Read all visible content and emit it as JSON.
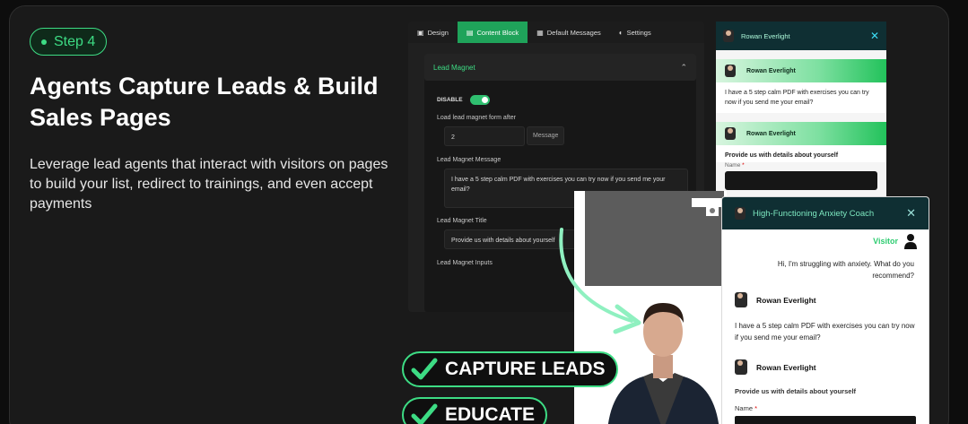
{
  "step_badge": "Step 4",
  "headline": "Agents Capture Leads & Build Sales Pages",
  "description": "Leverage lead agents that interact with visitors on pages to build your list, redirect to trainings, and even accept payments",
  "builder": {
    "tabs": [
      {
        "label": "Design",
        "icon": "layout-icon"
      },
      {
        "label": "Content Block",
        "icon": "block-icon"
      },
      {
        "label": "Default Messages",
        "icon": "message-icon"
      },
      {
        "label": "Settings",
        "icon": "gear-icon"
      }
    ],
    "section_title": "Lead Magnet",
    "disable_label": "DISABLE",
    "after_label": "Load lead magnet form after",
    "after_value": "2",
    "after_suffix": "Message",
    "message_label": "Lead Magnet Message",
    "message_value": "I have a 5 step calm PDF with exercises you can try now if you send me your email?",
    "title_label": "Lead Magnet Title",
    "title_value": "Provide us with details about yourself",
    "inputs_label": "Lead Magnet Inputs"
  },
  "chat_top": {
    "agent_name": "Rowan Everlight",
    "strip1_name": "Rowan Everlight",
    "message": "I have a 5 step calm PDF with exercises you can try now if you send me your email?",
    "strip2_name": "Rowan Everlight",
    "form_title": "Provide us with details about yourself",
    "name_label": "Name",
    "required_mark": "*"
  },
  "chat_bottom": {
    "title": "High-Functioning Anxiety Coach",
    "visitor_label": "Visitor",
    "visitor_message": "Hi, I'm struggling with anxiety. What do you recommend?",
    "agent_name": "Rowan Everlight",
    "agent_message": "I have a 5 step calm PDF with exercises you can try now if you send me your email?",
    "agent_name_2": "Rowan Everlight",
    "form_title": "Provide us with details about yourself",
    "name_label": "Name",
    "required_mark": "*"
  },
  "badges": [
    {
      "label": "CAPTURE LEADS"
    },
    {
      "label": "EDUCATE"
    }
  ],
  "colors": {
    "accent": "#3ddc84",
    "chat_header": "#0f2f33",
    "background": "#1a1a1a"
  }
}
